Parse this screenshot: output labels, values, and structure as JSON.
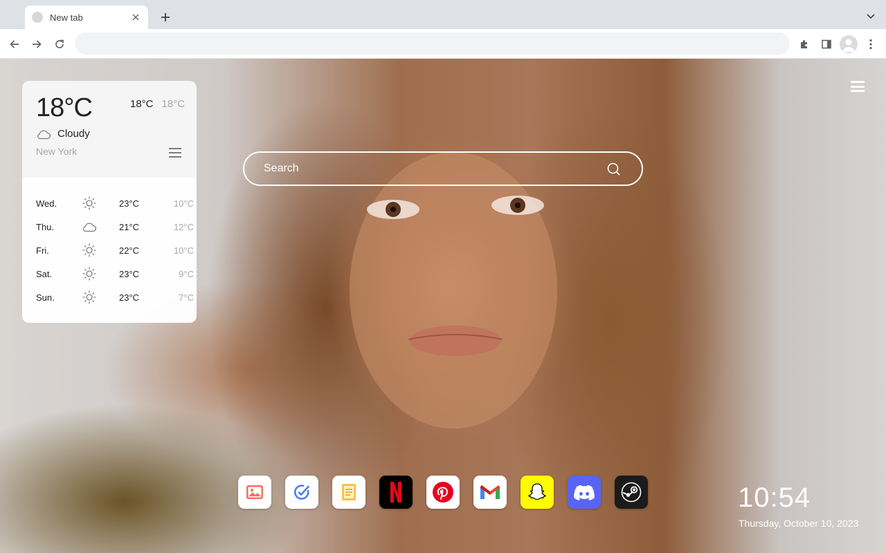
{
  "browser": {
    "tab_title": "New tab",
    "address_value": ""
  },
  "weather": {
    "current_temp": "18°C",
    "high": "18°C",
    "low": "18°C",
    "condition": "Cloudy",
    "city": "New York",
    "forecast": [
      {
        "day": "Wed.",
        "icon": "sun-icon",
        "high": "23°C",
        "low": "10°C"
      },
      {
        "day": "Thu.",
        "icon": "cloud-icon",
        "high": "21°C",
        "low": "12°C"
      },
      {
        "day": "Fri.",
        "icon": "sun-icon",
        "high": "22°C",
        "low": "10°C"
      },
      {
        "day": "Sat.",
        "icon": "sun-icon",
        "high": "23°C",
        "low": "9°C"
      },
      {
        "day": "Sun.",
        "icon": "sun-icon",
        "high": "23°C",
        "low": "7°C"
      }
    ]
  },
  "search": {
    "placeholder": "Search"
  },
  "dock": [
    {
      "name": "photos-app",
      "icon": "image-icon",
      "color": "#ffffff"
    },
    {
      "name": "checklist-app",
      "icon": "check-circle-icon",
      "color": "#ffffff"
    },
    {
      "name": "notes-app",
      "icon": "note-icon",
      "color": "#ffffff"
    },
    {
      "name": "netflix-app",
      "icon": "netflix-icon",
      "color": "#000000"
    },
    {
      "name": "pinterest-app",
      "icon": "pinterest-icon",
      "color": "#ffffff"
    },
    {
      "name": "gmail-app",
      "icon": "gmail-icon",
      "color": "#ffffff"
    },
    {
      "name": "snapchat-app",
      "icon": "snapchat-icon",
      "color": "#fffc00"
    },
    {
      "name": "discord-app",
      "icon": "discord-icon",
      "color": "#5865f2"
    },
    {
      "name": "steam-app",
      "icon": "steam-icon",
      "color": "#1b1b1b"
    }
  ],
  "clock": {
    "time": "10:54",
    "date": "Thursday, October 10, 2023"
  }
}
